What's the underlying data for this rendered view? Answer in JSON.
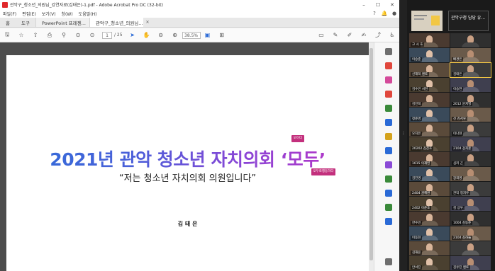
{
  "window": {
    "title": "관악구_청소년_의원님_강연자료(김태은)-1.pdf - Adobe Acrobat Pro DC (32-bit)"
  },
  "menu": [
    "파일(F)",
    "편집(E)",
    "보기(V)",
    "창(W)",
    "도움말(H)"
  ],
  "tabs": {
    "home": "홈",
    "tools": "도구",
    "documents": [
      {
        "label": "PowerPoint 프레젠...",
        "active": false
      },
      {
        "label": "관악구_청소년_의원님...",
        "active": true
      }
    ]
  },
  "toolbar": {
    "page_current": "1",
    "page_total": "/ 25",
    "zoom": "38.5%"
  },
  "slide": {
    "title": "2021년 관악 청소년 자치의회 ‘모두’",
    "subtitle": "“저는 청소년 자치의회 의원입니다”",
    "author": "김 태 은",
    "badge1": "모이다",
    "badge2": "모두로행동하다"
  },
  "zoom_panel": {
    "title": "관악구청 담당 유..."
  },
  "participants": [
    "고 시 호",
    "",
    "이승준",
    "배경은",
    "신재희 멘토",
    "김태은",
    "김수민 서천",
    "이승연",
    "김민희",
    "2012 문지영",
    "정준영",
    "신 김서우",
    "오지은",
    "이나현",
    "20202 김진호",
    "2104 강지훈",
    "1015 이재빈",
    "심리 곤",
    "김진영",
    "장희영",
    "2404 권혜원",
    "관악 정지우",
    "2402 이준호",
    "김 상우",
    "한수민",
    "1004 김동준",
    "이동현",
    "2104 김하늘",
    "김재윤",
    "",
    "안서진",
    "김유진 멘토"
  ],
  "colors": {
    "accent_blue": "#2f6fd9",
    "accent_magenta": "#c030c4",
    "badge": "#c3307d",
    "active_speaker": "#f2c744"
  }
}
